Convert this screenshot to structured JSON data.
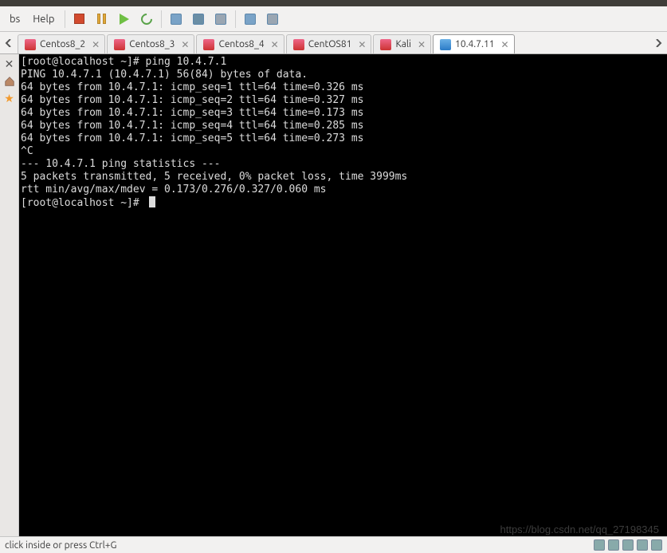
{
  "menu": {
    "item1": "bs",
    "item2": "Help"
  },
  "tabs": [
    {
      "label": "Centos8_2",
      "active": false,
      "icon": "red"
    },
    {
      "label": "Centos8_3",
      "active": false,
      "icon": "red"
    },
    {
      "label": "Centos8_4",
      "active": false,
      "icon": "red"
    },
    {
      "label": "CentOS81",
      "active": false,
      "icon": "red"
    },
    {
      "label": "Kali",
      "active": false,
      "icon": "red"
    },
    {
      "label": "10.4.7.11",
      "active": true,
      "icon": "blue"
    }
  ],
  "terminal": {
    "lines": [
      "[root@localhost ~]# ping 10.4.7.1",
      "PING 10.4.7.1 (10.4.7.1) 56(84) bytes of data.",
      "64 bytes from 10.4.7.1: icmp_seq=1 ttl=64 time=0.326 ms",
      "64 bytes from 10.4.7.1: icmp_seq=2 ttl=64 time=0.327 ms",
      "64 bytes from 10.4.7.1: icmp_seq=3 ttl=64 time=0.173 ms",
      "64 bytes from 10.4.7.1: icmp_seq=4 ttl=64 time=0.285 ms",
      "64 bytes from 10.4.7.1: icmp_seq=5 ttl=64 time=0.273 ms",
      "^C",
      "--- 10.4.7.1 ping statistics ---",
      "5 packets transmitted, 5 received, 0% packet loss, time 3999ms",
      "rtt min/avg/max/mdev = 0.173/0.276/0.327/0.060 ms",
      "[root@localhost ~]# "
    ]
  },
  "status": {
    "hint": "click inside or press Ctrl+G"
  },
  "watermark": "https://blog.csdn.net/qq_27198345"
}
